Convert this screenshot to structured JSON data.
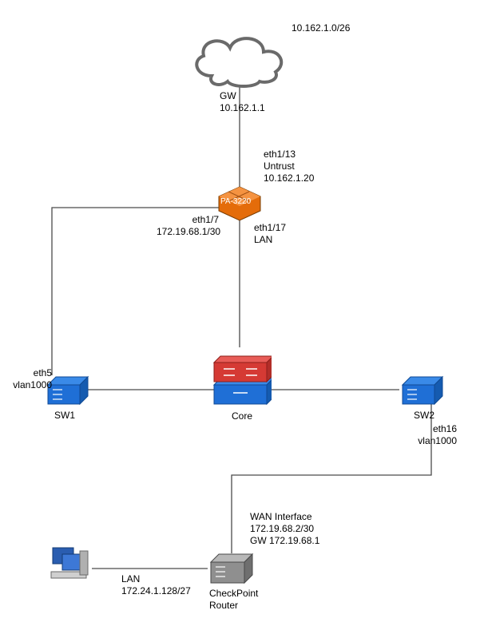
{
  "chart_data": {
    "type": "network-diagram",
    "nodes": [
      {
        "id": "cloud",
        "label_top": "10.162.1.0/26",
        "label_bottom": "GW\n10.162.1.1"
      },
      {
        "id": "pa3220",
        "label": "PA-3220"
      },
      {
        "id": "core",
        "label": "Core"
      },
      {
        "id": "sw1",
        "label": "SW1"
      },
      {
        "id": "sw2",
        "label": "SW2"
      },
      {
        "id": "checkpoint",
        "label": "CheckPoint\nRouter"
      },
      {
        "id": "pc",
        "label": ""
      }
    ],
    "edges": [
      {
        "from": "cloud",
        "to": "pa3220",
        "label_to": "eth1/13\nUntrust\n10.162.1.20"
      },
      {
        "from": "pa3220",
        "to": "core",
        "label_from": "eth1/17\nLAN"
      },
      {
        "from": "pa3220",
        "to": "sw1",
        "label_from": "eth1/7\n172.19.68.1/30",
        "label_to": "eth5\nvlan1000"
      },
      {
        "from": "core",
        "to": "sw1"
      },
      {
        "from": "core",
        "to": "sw2"
      },
      {
        "from": "sw2",
        "to": "checkpoint",
        "label_from": "eth16\nvlan1000",
        "label_to": "WAN Interface\n172.19.68.2/30\nGW 172.19.68.1"
      },
      {
        "from": "checkpoint",
        "to": "pc",
        "label_from": "LAN\n172.24.1.128/27"
      }
    ]
  },
  "labels": {
    "cloud_net": "10.162.1.0/26",
    "cloud_gw": "GW\n10.162.1.1",
    "pa_iface_wan": "eth1/13\nUntrust\n10.162.1.20",
    "pa_device": "PA-3220",
    "pa_iface_sw1": "eth1/7\n172.19.68.1/30",
    "pa_iface_core": "eth1/17\nLAN",
    "sw1_iface": "eth5\nvlan1000",
    "sw1": "SW1",
    "core": "Core",
    "sw2": "SW2",
    "sw2_iface": "eth16\nvlan1000",
    "cp_wan": "WAN Interface\n172.19.68.2/30\nGW 172.19.68.1",
    "cp": "CheckPoint\nRouter",
    "cp_lan": "LAN\n172.24.1.128/27"
  }
}
